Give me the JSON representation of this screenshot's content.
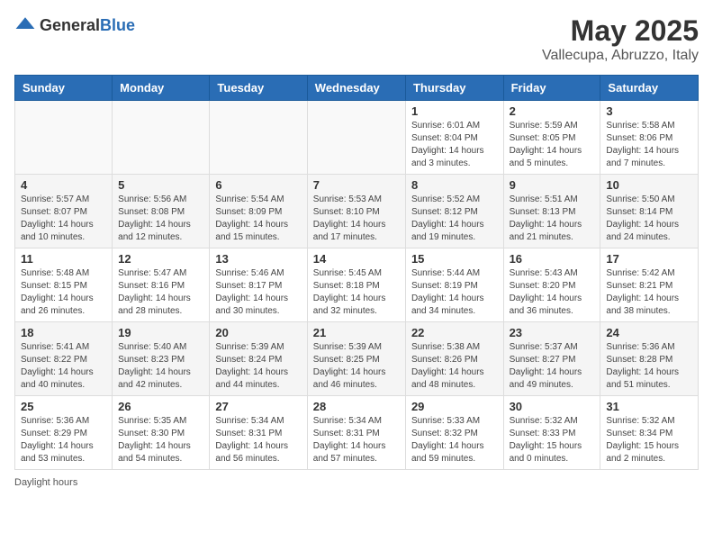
{
  "logo": {
    "general": "General",
    "blue": "Blue"
  },
  "title": "May 2025",
  "location": "Vallecupa, Abruzzo, Italy",
  "days_of_week": [
    "Sunday",
    "Monday",
    "Tuesday",
    "Wednesday",
    "Thursday",
    "Friday",
    "Saturday"
  ],
  "footer": "Daylight hours",
  "weeks": [
    [
      {
        "day": "",
        "info": ""
      },
      {
        "day": "",
        "info": ""
      },
      {
        "day": "",
        "info": ""
      },
      {
        "day": "",
        "info": ""
      },
      {
        "day": "1",
        "info": "Sunrise: 6:01 AM\nSunset: 8:04 PM\nDaylight: 14 hours\nand 3 minutes."
      },
      {
        "day": "2",
        "info": "Sunrise: 5:59 AM\nSunset: 8:05 PM\nDaylight: 14 hours\nand 5 minutes."
      },
      {
        "day": "3",
        "info": "Sunrise: 5:58 AM\nSunset: 8:06 PM\nDaylight: 14 hours\nand 7 minutes."
      }
    ],
    [
      {
        "day": "4",
        "info": "Sunrise: 5:57 AM\nSunset: 8:07 PM\nDaylight: 14 hours\nand 10 minutes."
      },
      {
        "day": "5",
        "info": "Sunrise: 5:56 AM\nSunset: 8:08 PM\nDaylight: 14 hours\nand 12 minutes."
      },
      {
        "day": "6",
        "info": "Sunrise: 5:54 AM\nSunset: 8:09 PM\nDaylight: 14 hours\nand 15 minutes."
      },
      {
        "day": "7",
        "info": "Sunrise: 5:53 AM\nSunset: 8:10 PM\nDaylight: 14 hours\nand 17 minutes."
      },
      {
        "day": "8",
        "info": "Sunrise: 5:52 AM\nSunset: 8:12 PM\nDaylight: 14 hours\nand 19 minutes."
      },
      {
        "day": "9",
        "info": "Sunrise: 5:51 AM\nSunset: 8:13 PM\nDaylight: 14 hours\nand 21 minutes."
      },
      {
        "day": "10",
        "info": "Sunrise: 5:50 AM\nSunset: 8:14 PM\nDaylight: 14 hours\nand 24 minutes."
      }
    ],
    [
      {
        "day": "11",
        "info": "Sunrise: 5:48 AM\nSunset: 8:15 PM\nDaylight: 14 hours\nand 26 minutes."
      },
      {
        "day": "12",
        "info": "Sunrise: 5:47 AM\nSunset: 8:16 PM\nDaylight: 14 hours\nand 28 minutes."
      },
      {
        "day": "13",
        "info": "Sunrise: 5:46 AM\nSunset: 8:17 PM\nDaylight: 14 hours\nand 30 minutes."
      },
      {
        "day": "14",
        "info": "Sunrise: 5:45 AM\nSunset: 8:18 PM\nDaylight: 14 hours\nand 32 minutes."
      },
      {
        "day": "15",
        "info": "Sunrise: 5:44 AM\nSunset: 8:19 PM\nDaylight: 14 hours\nand 34 minutes."
      },
      {
        "day": "16",
        "info": "Sunrise: 5:43 AM\nSunset: 8:20 PM\nDaylight: 14 hours\nand 36 minutes."
      },
      {
        "day": "17",
        "info": "Sunrise: 5:42 AM\nSunset: 8:21 PM\nDaylight: 14 hours\nand 38 minutes."
      }
    ],
    [
      {
        "day": "18",
        "info": "Sunrise: 5:41 AM\nSunset: 8:22 PM\nDaylight: 14 hours\nand 40 minutes."
      },
      {
        "day": "19",
        "info": "Sunrise: 5:40 AM\nSunset: 8:23 PM\nDaylight: 14 hours\nand 42 minutes."
      },
      {
        "day": "20",
        "info": "Sunrise: 5:39 AM\nSunset: 8:24 PM\nDaylight: 14 hours\nand 44 minutes."
      },
      {
        "day": "21",
        "info": "Sunrise: 5:39 AM\nSunset: 8:25 PM\nDaylight: 14 hours\nand 46 minutes."
      },
      {
        "day": "22",
        "info": "Sunrise: 5:38 AM\nSunset: 8:26 PM\nDaylight: 14 hours\nand 48 minutes."
      },
      {
        "day": "23",
        "info": "Sunrise: 5:37 AM\nSunset: 8:27 PM\nDaylight: 14 hours\nand 49 minutes."
      },
      {
        "day": "24",
        "info": "Sunrise: 5:36 AM\nSunset: 8:28 PM\nDaylight: 14 hours\nand 51 minutes."
      }
    ],
    [
      {
        "day": "25",
        "info": "Sunrise: 5:36 AM\nSunset: 8:29 PM\nDaylight: 14 hours\nand 53 minutes."
      },
      {
        "day": "26",
        "info": "Sunrise: 5:35 AM\nSunset: 8:30 PM\nDaylight: 14 hours\nand 54 minutes."
      },
      {
        "day": "27",
        "info": "Sunrise: 5:34 AM\nSunset: 8:31 PM\nDaylight: 14 hours\nand 56 minutes."
      },
      {
        "day": "28",
        "info": "Sunrise: 5:34 AM\nSunset: 8:31 PM\nDaylight: 14 hours\nand 57 minutes."
      },
      {
        "day": "29",
        "info": "Sunrise: 5:33 AM\nSunset: 8:32 PM\nDaylight: 14 hours\nand 59 minutes."
      },
      {
        "day": "30",
        "info": "Sunrise: 5:32 AM\nSunset: 8:33 PM\nDaylight: 15 hours\nand 0 minutes."
      },
      {
        "day": "31",
        "info": "Sunrise: 5:32 AM\nSunset: 8:34 PM\nDaylight: 15 hours\nand 2 minutes."
      }
    ]
  ]
}
